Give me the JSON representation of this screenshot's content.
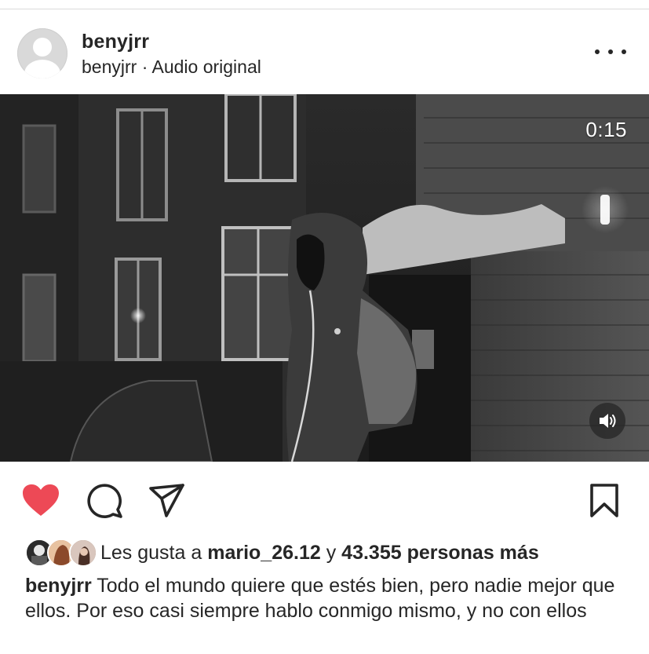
{
  "post": {
    "username": "benyjrr",
    "subtitle_user": "benyjrr",
    "subtitle_separator": " · ",
    "subtitle_audio": "Audio original",
    "more_icon": "more-horizontal-icon"
  },
  "video": {
    "time_remaining": "0:15",
    "mute_icon": "speaker-icon"
  },
  "actions": {
    "like_icon": "heart-filled-icon",
    "like_color": "#ed4956",
    "comment_icon": "comment-icon",
    "share_icon": "send-icon",
    "save_icon": "bookmark-icon"
  },
  "likes": {
    "prefix": "Les gusta a ",
    "user": "mario_26.12",
    "joiner": " y ",
    "count": "43.355 personas más"
  },
  "caption": {
    "username": "benyjrr",
    "text": " Todo el mundo quiere que estés bien, pero nadie mejor que ellos. Por eso casi siempre hablo conmigo mismo, y no con ellos"
  }
}
